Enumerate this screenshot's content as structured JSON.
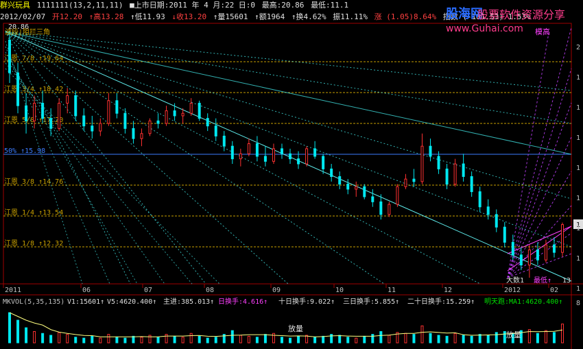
{
  "header1": {
    "stock_name": "群兴玩具",
    "indicator_params": "1111111(13,2,11,11)",
    "list_date": "■上市日期:2011 年 4 月:22 日:0",
    "high": "最高:20.86",
    "low": "最低:11.1"
  },
  "header2": {
    "date": "2012/02/07",
    "open": "开12.20",
    "high": "↑高13.28",
    "low": "↑低11.93",
    "close": "↓收13.20",
    "volume": "↑量15601",
    "amount": "↑额1964",
    "turnover": "↑换4.62%",
    "amplitude": "振11.11%",
    "change": "涨 (1.05)8.64%",
    "index": "指数 (-181.53) 1.53%"
  },
  "watermark": {
    "site_cn": "股海网",
    "slogan": "股票软件资源分享",
    "url": "www.Guhai.com"
  },
  "chart_labels": {
    "top_left_price": "20.86",
    "top_left_tag": "波段|阻拦三角",
    "top_right_tag": "模高",
    "bottom_tags": [
      "大数1",
      "最低↑"
    ],
    "bottom_right": "13",
    "right_tag": "1"
  },
  "fib_levels": [
    {
      "label": "江恩 7/8 ↑19.64",
      "price": 19.64,
      "color": "#c8a000"
    },
    {
      "label": "江恩 3/4 ↑18.42",
      "price": 18.42,
      "color": "#c8a000"
    },
    {
      "label": "江恩 5/8 ↑17.20",
      "price": 17.2,
      "color": "#c8a000"
    },
    {
      "label": "50% ↑15.98",
      "price": 15.98,
      "color": "#3c7cff"
    },
    {
      "label": "江恩 3/8 ↑14.76",
      "price": 14.76,
      "color": "#c8a000"
    },
    {
      "label": "江恩 1/4 ↑13.54",
      "price": 13.54,
      "color": "#c8a000"
    },
    {
      "label": "江恩 1/8 ↑12.32",
      "price": 12.32,
      "color": "#c8a000"
    }
  ],
  "x_axis_labels": [
    "2011",
    "06",
    "07",
    "08",
    "09",
    "10",
    "11",
    "12",
    "2012",
    "02"
  ],
  "y_axis_labels": [
    "2",
    "1",
    "1",
    "1",
    "1",
    "1",
    "1",
    "1",
    "1"
  ],
  "volume_header": {
    "name": "MKVOL(5,35,135)",
    "v1": "V1:15601↑",
    "v5": "V5:4620.400↑",
    "main": "主进:385.013↑",
    "day_turn": "日换手:4.616↑",
    "ten_turn": "十日换手:9.022↑",
    "three_turn": "三日换手:5.855↑",
    "twenty_turn": "二十日换手:15.259↑",
    "tomorrow": "明天跑:MA1:4620.400↑"
  },
  "volume_labels": [
    "放量",
    "放量"
  ],
  "volume_y_label": "8",
  "chart_data": {
    "type": "candlestick",
    "price_range": [
      11.1,
      20.86
    ],
    "ohlc": [
      [
        20.5,
        20.86,
        18.8,
        19.2
      ],
      [
        19.2,
        19.6,
        17.6,
        17.9
      ],
      [
        17.9,
        18.4,
        16.8,
        17.3
      ],
      [
        17.3,
        18.3,
        17.0,
        18.0
      ],
      [
        18.0,
        18.5,
        17.2,
        17.4
      ],
      [
        17.4,
        17.8,
        16.7,
        17.0
      ],
      [
        17.0,
        18.2,
        16.9,
        18.0
      ],
      [
        18.0,
        18.6,
        17.6,
        18.3
      ],
      [
        18.3,
        18.5,
        17.3,
        17.5
      ],
      [
        17.5,
        17.8,
        16.9,
        17.1
      ],
      [
        17.1,
        17.5,
        16.6,
        16.9
      ],
      [
        16.9,
        17.4,
        16.7,
        17.2
      ],
      [
        17.2,
        18.4,
        17.1,
        18.1
      ],
      [
        18.1,
        18.4,
        17.4,
        17.6
      ],
      [
        17.6,
        17.8,
        16.8,
        17.0
      ],
      [
        17.0,
        17.3,
        16.4,
        16.6
      ],
      [
        16.6,
        17.0,
        16.3,
        16.8
      ],
      [
        16.8,
        17.4,
        16.7,
        17.3
      ],
      [
        17.3,
        17.6,
        17.0,
        17.2
      ],
      [
        17.2,
        17.9,
        17.1,
        17.7
      ],
      [
        17.7,
        18.0,
        17.3,
        17.5
      ],
      [
        17.5,
        17.8,
        17.2,
        17.6
      ],
      [
        17.6,
        18.2,
        17.5,
        18.0
      ],
      [
        18.0,
        18.1,
        17.3,
        17.4
      ],
      [
        17.4,
        17.6,
        16.9,
        17.1
      ],
      [
        17.1,
        17.4,
        16.5,
        16.7
      ],
      [
        16.7,
        16.9,
        16.1,
        16.3
      ],
      [
        16.3,
        16.5,
        15.6,
        15.8
      ],
      [
        15.8,
        16.2,
        15.5,
        16.0
      ],
      [
        16.0,
        16.6,
        15.9,
        16.4
      ],
      [
        16.4,
        16.7,
        15.7,
        15.9
      ],
      [
        15.9,
        16.3,
        15.5,
        15.7
      ],
      [
        15.7,
        16.4,
        15.6,
        16.2
      ],
      [
        16.2,
        16.4,
        15.8,
        16.0
      ],
      [
        16.0,
        16.2,
        15.6,
        15.8
      ],
      [
        15.8,
        16.1,
        15.4,
        15.6
      ],
      [
        15.6,
        16.3,
        15.5,
        16.2
      ],
      [
        16.2,
        16.5,
        15.8,
        15.9
      ],
      [
        15.9,
        16.0,
        15.2,
        15.4
      ],
      [
        15.4,
        15.6,
        14.9,
        15.1
      ],
      [
        15.1,
        15.3,
        14.6,
        14.8
      ],
      [
        14.8,
        15.0,
        14.4,
        14.6
      ],
      [
        14.6,
        14.9,
        14.3,
        14.7
      ],
      [
        14.7,
        14.8,
        14.2,
        14.3
      ],
      [
        14.3,
        14.6,
        13.9,
        14.1
      ],
      [
        14.1,
        14.4,
        13.4,
        13.6
      ],
      [
        13.6,
        14.1,
        13.5,
        14.0
      ],
      [
        14.0,
        14.8,
        13.9,
        14.7
      ],
      [
        14.7,
        15.2,
        14.6,
        15.0
      ],
      [
        15.0,
        15.4,
        14.7,
        14.9
      ],
      [
        14.9,
        16.8,
        14.8,
        16.3
      ],
      [
        16.3,
        16.6,
        15.7,
        15.9
      ],
      [
        15.9,
        16.1,
        15.2,
        15.4
      ],
      [
        15.4,
        15.6,
        14.6,
        14.8
      ],
      [
        14.8,
        15.8,
        14.7,
        15.6
      ],
      [
        15.6,
        16.0,
        14.9,
        15.1
      ],
      [
        15.1,
        15.3,
        14.3,
        14.5
      ],
      [
        14.5,
        14.7,
        13.7,
        13.9
      ],
      [
        13.9,
        14.2,
        13.4,
        13.6
      ],
      [
        13.6,
        13.8,
        12.9,
        13.1
      ],
      [
        13.1,
        13.3,
        12.3,
        12.5
      ],
      [
        12.5,
        12.8,
        11.8,
        12.0
      ],
      [
        12.0,
        12.3,
        11.4,
        11.6
      ],
      [
        11.6,
        12.4,
        11.1,
        12.2
      ],
      [
        12.2,
        12.5,
        11.6,
        11.8
      ],
      [
        11.8,
        12.6,
        11.7,
        12.4
      ],
      [
        12.4,
        12.7,
        11.9,
        12.1
      ],
      [
        12.1,
        13.28,
        11.93,
        13.2
      ]
    ],
    "volume": [
      3.2,
      2.4,
      1.6,
      1.2,
      1.0,
      0.8,
      1.1,
      0.9,
      0.6,
      0.5,
      0.7,
      0.5,
      0.9,
      0.6,
      0.5,
      0.7,
      0.6,
      0.8,
      0.6,
      0.9,
      0.7,
      0.6,
      1.0,
      0.7,
      0.5,
      0.6,
      0.9,
      1.3,
      0.8,
      0.7,
      0.6,
      0.9,
      1.0,
      0.6,
      0.5,
      0.7,
      0.8,
      0.6,
      0.7,
      0.9,
      0.8,
      0.6,
      0.5,
      0.7,
      0.9,
      1.2,
      0.8,
      1.1,
      1.0,
      0.9,
      1.8,
      1.0,
      0.8,
      0.7,
      1.0,
      0.8,
      0.7,
      0.9,
      0.8,
      1.1,
      1.2,
      1.0,
      1.3,
      1.4,
      1.0,
      1.3,
      1.1,
      2.0
    ]
  }
}
